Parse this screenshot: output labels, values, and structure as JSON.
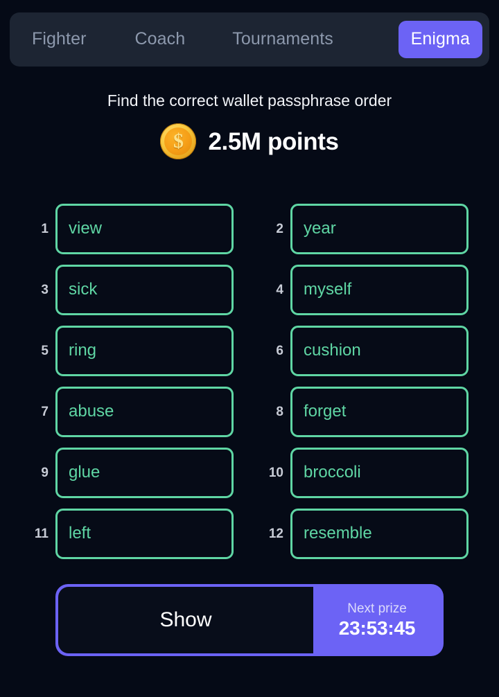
{
  "nav": {
    "tabs": [
      {
        "label": "Fighter",
        "active": false
      },
      {
        "label": "Coach",
        "active": false
      },
      {
        "label": "Tournaments",
        "active": false
      },
      {
        "label": "Enigma",
        "active": true
      }
    ]
  },
  "header": {
    "prompt": "Find the correct wallet passphrase order",
    "coin_icon": "coin-dollar-icon",
    "coin_glyph": "$",
    "prize_amount": "2.5M points"
  },
  "grid": {
    "words": [
      {
        "index": "1",
        "word": "view"
      },
      {
        "index": "2",
        "word": "year"
      },
      {
        "index": "3",
        "word": "sick"
      },
      {
        "index": "4",
        "word": "myself"
      },
      {
        "index": "5",
        "word": "ring"
      },
      {
        "index": "6",
        "word": "cushion"
      },
      {
        "index": "7",
        "word": "abuse"
      },
      {
        "index": "8",
        "word": "forget"
      },
      {
        "index": "9",
        "word": "glue"
      },
      {
        "index": "10",
        "word": "broccoli"
      },
      {
        "index": "11",
        "word": "left"
      },
      {
        "index": "12",
        "word": "resemble"
      }
    ]
  },
  "action_bar": {
    "show_label": "Show",
    "next_prize_label": "Next prize",
    "next_prize_timer": "23:53:45"
  },
  "colors": {
    "page_background": "#050a16",
    "nav_background": "#1d2533",
    "accent_purple": "#6c63f5",
    "accent_green": "#5fd6a4",
    "coin_gold": "#f5ae1e",
    "inactive_tab_text": "#8d99ad",
    "index_text": "#c8ccd6"
  }
}
